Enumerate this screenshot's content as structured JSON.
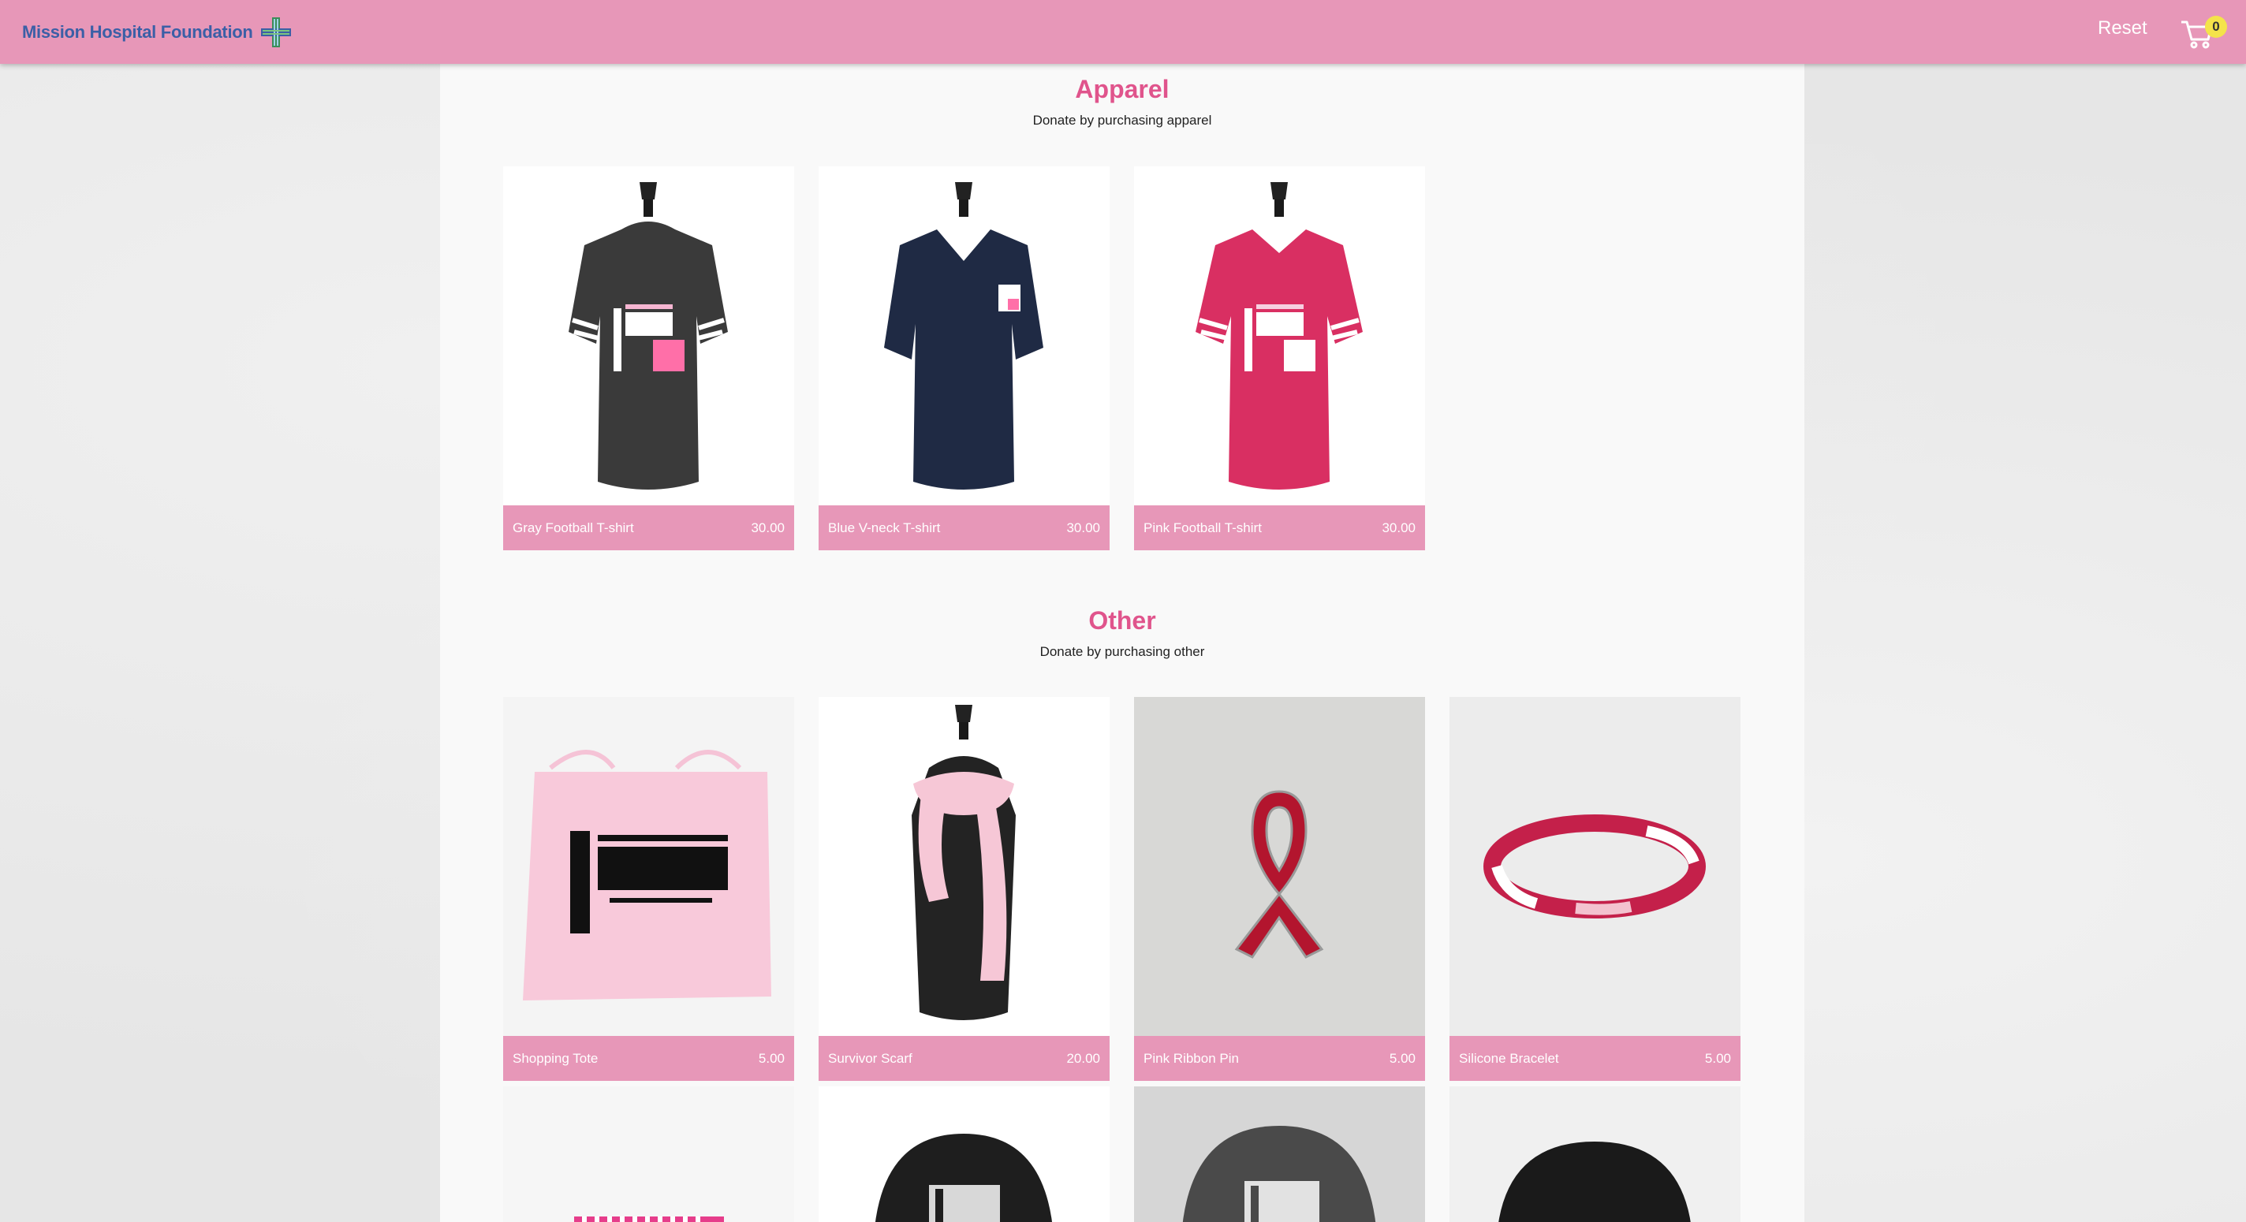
{
  "header": {
    "brand": "Mission Hospital Foundation",
    "reset_label": "Reset",
    "cart_count": "0"
  },
  "sections": [
    {
      "title": "Apparel",
      "subtitle": "Donate by purchasing apparel",
      "items": [
        {
          "name": "Gray Football T-shirt",
          "price": "30.00"
        },
        {
          "name": "Blue V-neck T-shirt",
          "price": "30.00"
        },
        {
          "name": "Pink Football T-shirt",
          "price": "30.00"
        }
      ]
    },
    {
      "title": "Other",
      "subtitle": "Donate by purchasing other",
      "items": [
        {
          "name": "Shopping Tote",
          "price": "5.00"
        },
        {
          "name": "Survivor Scarf",
          "price": "20.00"
        },
        {
          "name": "Pink Ribbon Pin",
          "price": "5.00"
        },
        {
          "name": "Silicone Bracelet",
          "price": "5.00"
        }
      ]
    }
  ],
  "colors": {
    "header_bg": "#e797b8",
    "accent": "#e0548c",
    "brand_text": "#3b5fa6",
    "badge": "#f4e34a"
  }
}
